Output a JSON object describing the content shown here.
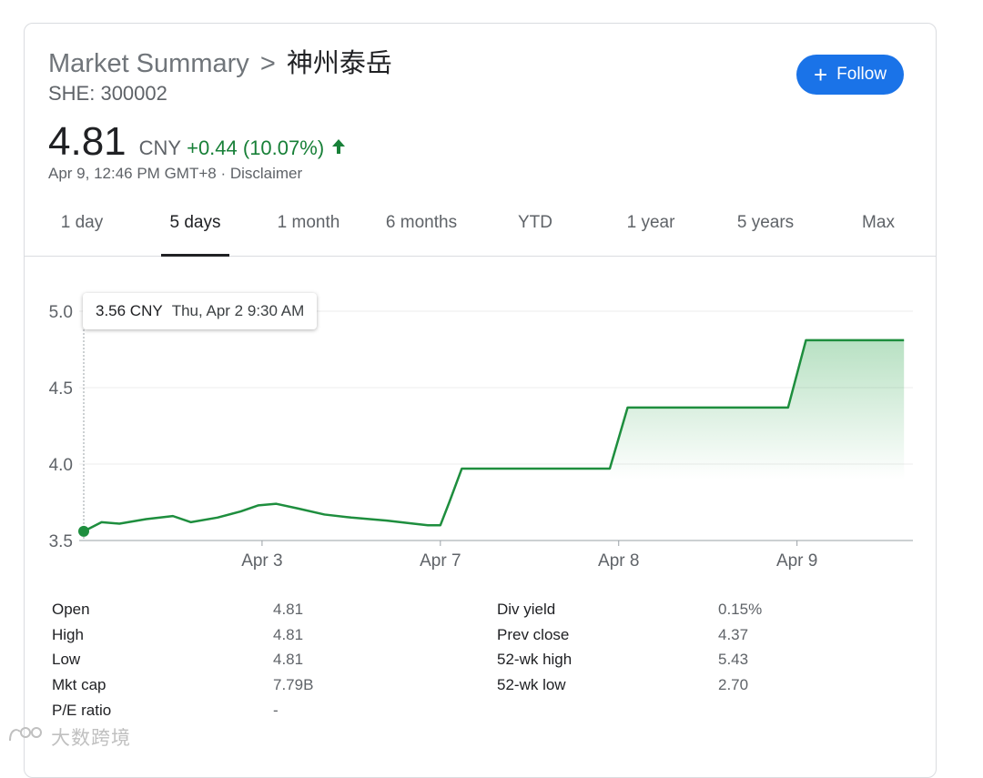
{
  "header": {
    "breadcrumb_root": "Market Summary",
    "breadcrumb_sep": ">",
    "company_name": "神州泰岳",
    "ticker": "SHE: 300002",
    "follow_label": "Follow"
  },
  "quote": {
    "price": "4.81",
    "currency": "CNY",
    "change": "+0.44 (10.07%)",
    "timestamp": "Apr 9, 12:46 PM GMT+8 · Disclaimer"
  },
  "tabs": [
    {
      "label": "1 day",
      "active": false
    },
    {
      "label": "5 days",
      "active": true
    },
    {
      "label": "1 month",
      "active": false
    },
    {
      "label": "6 months",
      "active": false
    },
    {
      "label": "YTD",
      "active": false
    },
    {
      "label": "1 year",
      "active": false
    },
    {
      "label": "5 years",
      "active": false
    },
    {
      "label": "Max",
      "active": false
    }
  ],
  "tooltip": {
    "price": "3.56 CNY",
    "time": "Thu, Apr 2 9:30 AM"
  },
  "colors": {
    "line": "#1e8e3e",
    "positive": "#188038",
    "accent": "#1a73e8"
  },
  "chart_data": {
    "type": "line",
    "ylim": [
      3.5,
      5.0
    ],
    "yticks": [
      "3.5",
      "4.0",
      "4.5",
      "5.0"
    ],
    "xticks": [
      {
        "label": "Apr 3",
        "x": 1.0
      },
      {
        "label": "Apr 7",
        "x": 2.0
      },
      {
        "label": "Apr 8",
        "x": 3.0
      },
      {
        "label": "Apr 9",
        "x": 4.0
      }
    ],
    "x": [
      0.0,
      0.1,
      0.2,
      0.35,
      0.5,
      0.6,
      0.75,
      0.88,
      0.98,
      1.08,
      1.2,
      1.35,
      1.5,
      1.7,
      1.85,
      1.93,
      2.0,
      2.05,
      2.12,
      2.2,
      2.5,
      2.95,
      3.05,
      3.5,
      3.95,
      4.05,
      4.6
    ],
    "values": [
      3.56,
      3.62,
      3.61,
      3.64,
      3.66,
      3.62,
      3.65,
      3.69,
      3.73,
      3.74,
      3.71,
      3.67,
      3.65,
      3.63,
      3.61,
      3.6,
      3.6,
      3.75,
      3.97,
      3.97,
      3.97,
      3.97,
      4.37,
      4.37,
      4.37,
      4.81,
      4.81
    ],
    "x_range": [
      0.0,
      4.65
    ]
  },
  "stats": {
    "left": [
      {
        "label": "Open",
        "value": "4.81"
      },
      {
        "label": "High",
        "value": "4.81"
      },
      {
        "label": "Low",
        "value": "4.81"
      },
      {
        "label": "Mkt cap",
        "value": "7.79B"
      },
      {
        "label": "P/E ratio",
        "value": "-"
      }
    ],
    "right": [
      {
        "label": "Div yield",
        "value": "0.15%"
      },
      {
        "label": "Prev close",
        "value": "4.37"
      },
      {
        "label": "52-wk high",
        "value": "5.43"
      },
      {
        "label": "52-wk low",
        "value": "2.70"
      }
    ]
  },
  "watermark": {
    "text": "大数跨境"
  }
}
